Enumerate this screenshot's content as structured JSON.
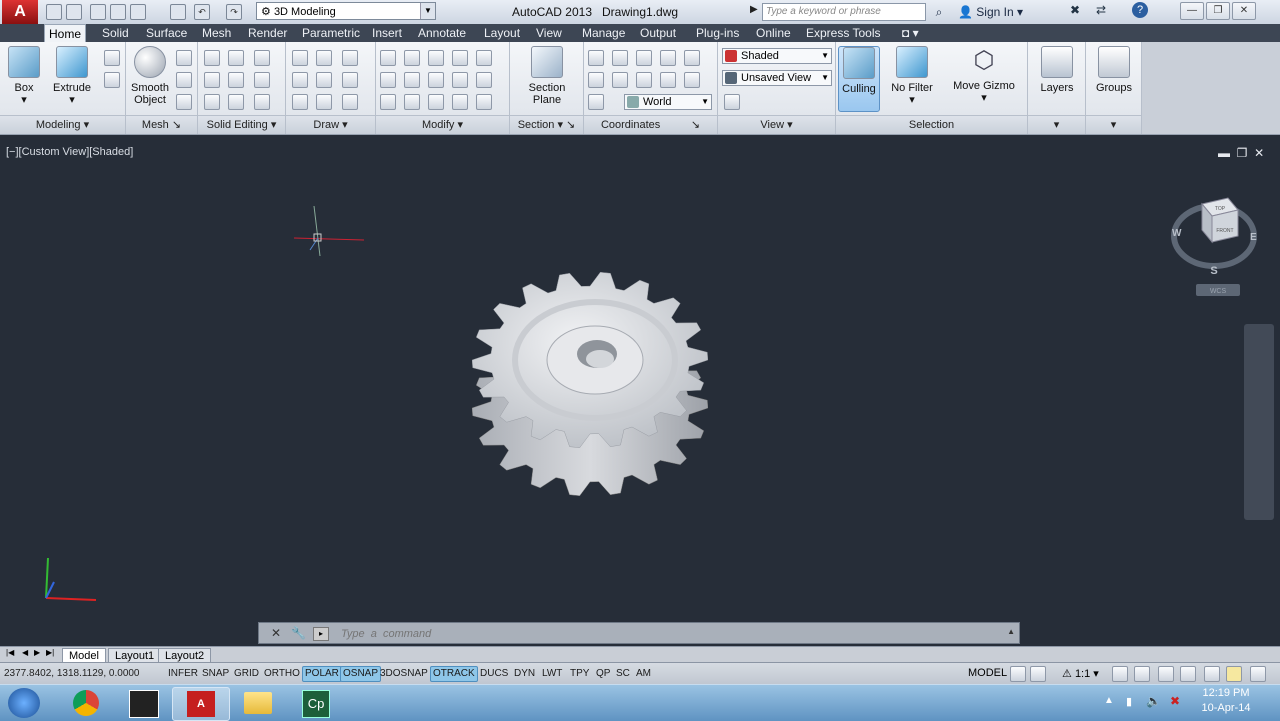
{
  "titlebar": {
    "app_button_label": "A",
    "workspace": "3D Modeling",
    "app_title": "AutoCAD 2013",
    "file_name": "Drawing1.dwg",
    "search_placeholder": "Type a keyword or phrase",
    "sign_in": "Sign In"
  },
  "tabs": [
    "Home",
    "Solid",
    "Surface",
    "Mesh",
    "Render",
    "Parametric",
    "Insert",
    "Annotate",
    "Layout",
    "View",
    "Manage",
    "Output",
    "Plug-ins",
    "Online",
    "Express Tools"
  ],
  "active_tab": "Home",
  "ribbon": {
    "modeling": {
      "title": "Modeling",
      "box": "Box",
      "extrude": "Extrude"
    },
    "mesh": {
      "title": "Mesh",
      "smooth_object_1": "Smooth",
      "smooth_object_2": "Object"
    },
    "solid_editing": {
      "title": "Solid Editing"
    },
    "draw": {
      "title": "Draw"
    },
    "modify": {
      "title": "Modify"
    },
    "section": {
      "title": "Section",
      "section_plane_1": "Section",
      "section_plane_2": "Plane"
    },
    "coordinates": {
      "title": "Coordinates",
      "ucs": "World"
    },
    "view": {
      "title": "View",
      "visual_style": "Shaded",
      "named_view": "Unsaved View"
    },
    "selection": {
      "title": "Selection",
      "culling": "Culling",
      "no_filter": "No Filter",
      "move_gizmo": "Move Gizmo"
    },
    "layers": {
      "label": "Layers"
    },
    "groups": {
      "label": "Groups"
    }
  },
  "viewport": {
    "label": "[−][Custom View][Shaded]",
    "viewcube": {
      "top": "TOP",
      "front": "FRONT",
      "w": "W",
      "e": "E",
      "s": "S",
      "wcs": "WCS"
    }
  },
  "command_line": {
    "placeholder": "Type  a  command"
  },
  "layout_tabs": [
    "Model",
    "Layout1",
    "Layout2"
  ],
  "active_layout": "Model",
  "status": {
    "coords": "2377.8402, 1318.1129, 0.0000",
    "toggles": [
      {
        "label": "INFER",
        "on": false
      },
      {
        "label": "SNAP",
        "on": false
      },
      {
        "label": "GRID",
        "on": false
      },
      {
        "label": "ORTHO",
        "on": false
      },
      {
        "label": "POLAR",
        "on": true
      },
      {
        "label": "OSNAP",
        "on": true
      },
      {
        "label": "3DOSNAP",
        "on": false
      },
      {
        "label": "OTRACK",
        "on": true
      },
      {
        "label": "DUCS",
        "on": false
      },
      {
        "label": "DYN",
        "on": false
      },
      {
        "label": "LWT",
        "on": false
      },
      {
        "label": "TPY",
        "on": false
      },
      {
        "label": "QP",
        "on": false
      },
      {
        "label": "SC",
        "on": false
      },
      {
        "label": "AM",
        "on": false
      }
    ],
    "model": "MODEL",
    "scale": "1:1"
  },
  "taskbar": {
    "time": "12:19 PM",
    "date": "10-Apr-14",
    "cp_label": "Cp"
  },
  "colors": {
    "viewport_bg": "#262d38",
    "toggle_on": "#8ec6e8",
    "app_red": "#c51f1f"
  }
}
